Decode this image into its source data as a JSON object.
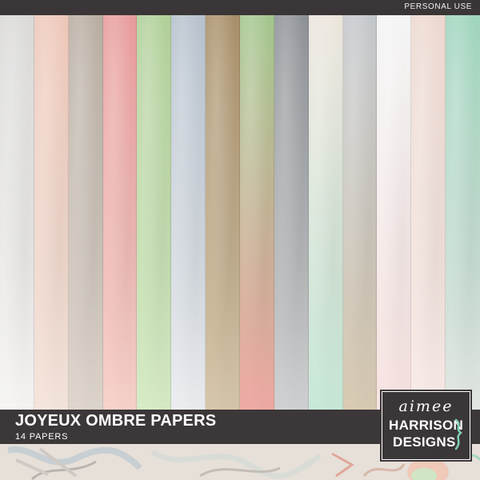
{
  "header": {
    "usage_label": "PERSONAL USE"
  },
  "product": {
    "title": "JOYEUX OMBRE PAPERS",
    "subtitle": "14 PAPERS"
  },
  "logo": {
    "line1": "aimee",
    "line2": "HARRISON",
    "line3": "DESIGNS",
    "accent_color": "#7fd1b2"
  },
  "papers": [
    {
      "top": "#dad9d8",
      "bottom": "#f6f5f3"
    },
    {
      "top": "#edc7b9",
      "bottom": "#f4e5dc"
    },
    {
      "top": "#b8aea2",
      "bottom": "#ded6cd"
    },
    {
      "top": "#e79b9b",
      "bottom": "#f7d2cc"
    },
    {
      "top": "#b1cf99",
      "bottom": "#d6ebc6"
    },
    {
      "top": "#b6c1cc",
      "bottom": "#ebedf0"
    },
    {
      "top": "#a88f6a",
      "bottom": "#d6c6aa"
    },
    {
      "top": "#a3c68e",
      "bottom": "#efaaa5"
    },
    {
      "top": "#8e9296",
      "bottom": "#d0d1d2"
    },
    {
      "top": "#ece5dc",
      "bottom": "#c8e8d8"
    },
    {
      "top": "#c3c7cb",
      "bottom": "#d8cab3"
    },
    {
      "top": "#f4f4f4",
      "bottom": "#f7e3e1"
    },
    {
      "top": "#ecd8cf",
      "bottom": "#f8ebe8"
    },
    {
      "top": "#9fd4bd",
      "bottom": "#e3e7e2"
    }
  ]
}
